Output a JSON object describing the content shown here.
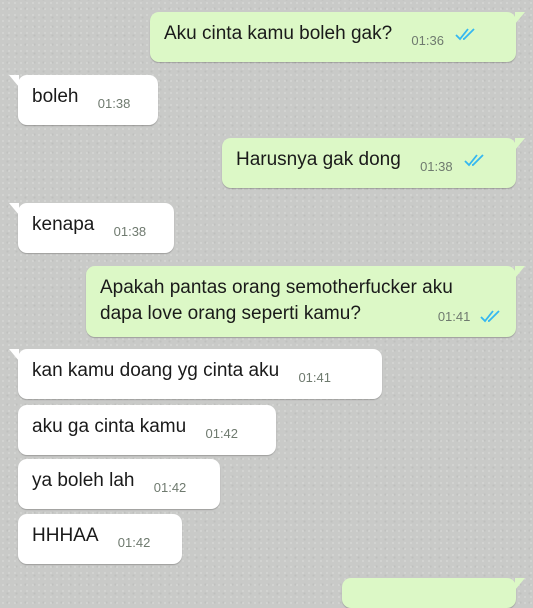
{
  "messages": [
    {
      "dir": "out",
      "text": "Aku cinta kamu boleh gak?",
      "time": "01:36",
      "status": "read"
    },
    {
      "dir": "in",
      "text": "boleh",
      "time": "01:38"
    },
    {
      "dir": "out",
      "text": "Harusnya gak dong",
      "time": "01:38",
      "status": "read"
    },
    {
      "dir": "in",
      "text": "kenapa",
      "time": "01:38"
    },
    {
      "dir": "out",
      "text": "Apakah pantas orang semotherfucker aku dapa love orang seperti kamu?",
      "line1": "Apakah pantas orang semotherfucker aku",
      "line2": "dapa love orang seperti kamu?",
      "time": "01:41",
      "status": "read"
    },
    {
      "dir": "in",
      "text": "kan kamu doang yg cinta aku",
      "time": "01:41"
    },
    {
      "dir": "in",
      "text": "aku ga cinta kamu",
      "time": "01:42"
    },
    {
      "dir": "in",
      "text": "ya boleh lah",
      "time": "01:42"
    },
    {
      "dir": "in",
      "text": "HHHAA",
      "time": "01:42"
    }
  ],
  "colors": {
    "outgoing": "#dcf8c6",
    "incoming": "#ffffff",
    "read_tick": "#34b7f1",
    "background": "#c9cac8"
  },
  "icons": {
    "read_status": "double-check-icon"
  }
}
